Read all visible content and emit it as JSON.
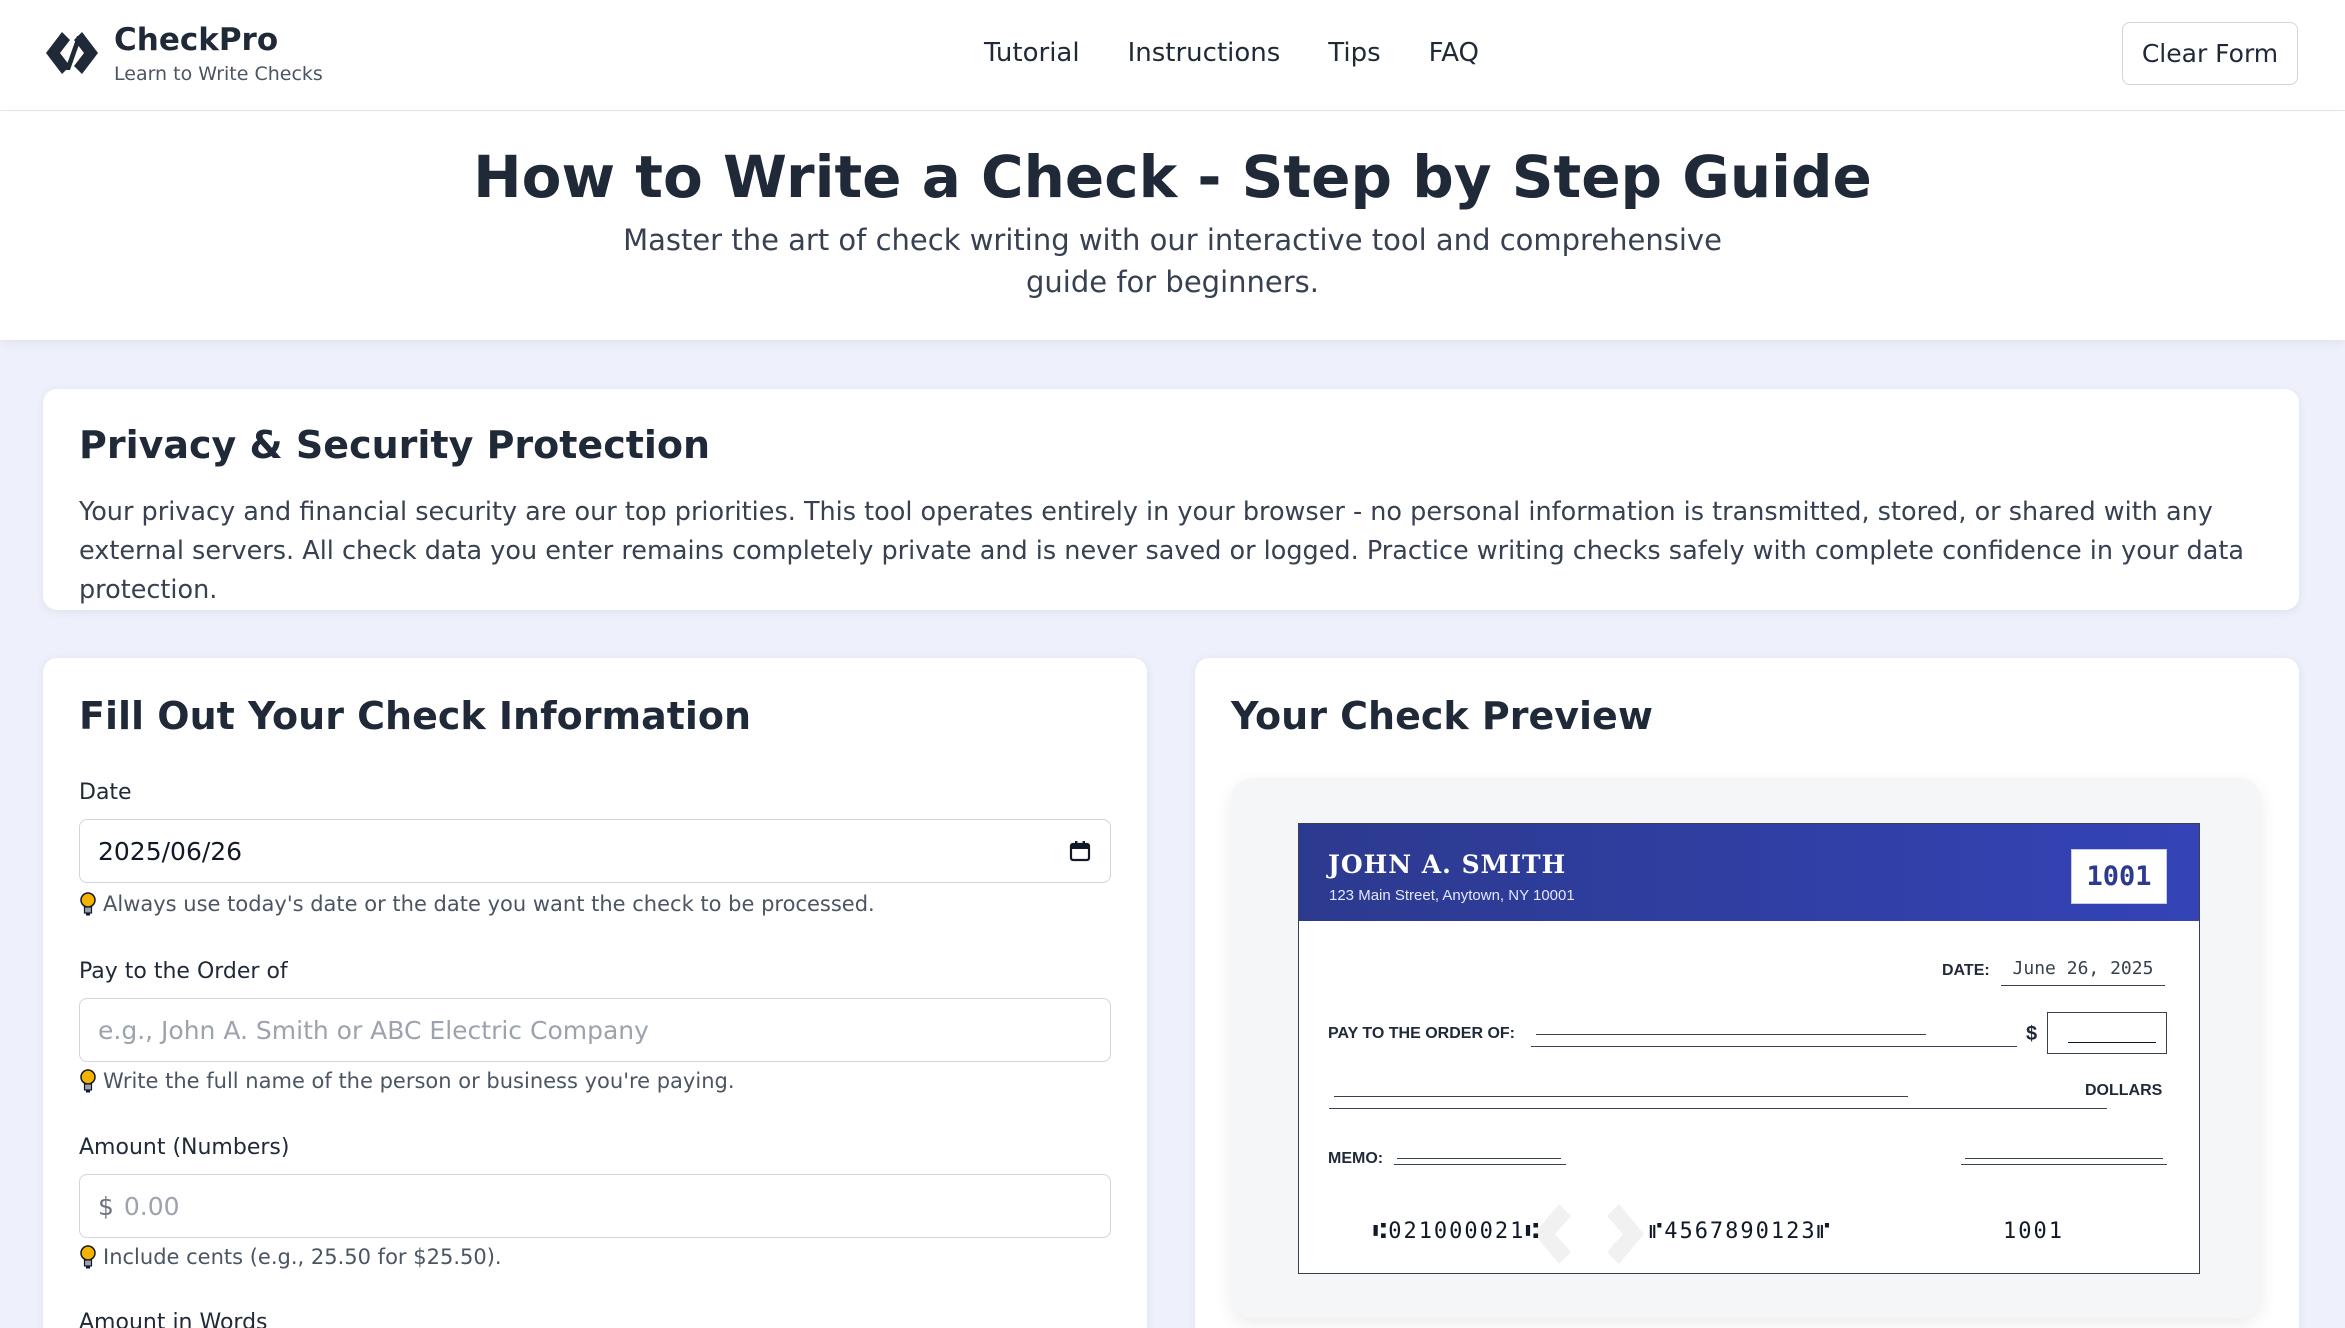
{
  "header": {
    "brand_name": "CheckPro",
    "brand_tagline": "Learn to Write Checks",
    "nav": [
      "Tutorial",
      "Instructions",
      "Tips",
      "FAQ"
    ],
    "clear_button": "Clear Form"
  },
  "hero": {
    "title": "How to Write a Check - Step by Step Guide",
    "subtitle": "Master the art of check writing with our interactive tool and comprehensive guide for beginners."
  },
  "privacy": {
    "title": "Privacy & Security Protection",
    "text": "Your privacy and financial security are our top priorities. This tool operates entirely in your browser - no personal information is transmitted, stored, or shared with any external servers. All check data you enter remains completely private and is never saved or logged. Practice writing checks safely with complete confidence in your data protection."
  },
  "form": {
    "title": "Fill Out Your Check Information",
    "date_label": "Date",
    "date_value": "2025/06/26",
    "date_hint": "Always use today's date or the date you want the check to be processed.",
    "payee_label": "Pay to the Order of",
    "payee_placeholder": "e.g., John A. Smith or ABC Electric Company",
    "payee_hint": "Write the full name of the person or business you're paying.",
    "amount_label": "Amount (Numbers)",
    "amount_symbol": "$",
    "amount_placeholder": "0.00",
    "amount_hint": "Include cents (e.g., 25.50 for $25.50).",
    "words_label": "Amount in Words"
  },
  "preview": {
    "title": "Your Check Preview",
    "owner": "JOHN A. SMITH",
    "address": "123 Main Street, Anytown, NY 10001",
    "check_number": "1001",
    "date_label": "DATE:",
    "date_value": "June 26, 2025",
    "payee_label": "PAY TO THE ORDER OF:",
    "dollar_sign": "$",
    "dollars_label": "DOLLARS",
    "memo_label": "MEMO:",
    "routing": "⑆021000021⑆",
    "account": "⑈4567890123⑈",
    "micr_check_number": "1001"
  },
  "colors": {
    "accent": "#3443b6",
    "page_bg": "#eef1fb",
    "text": "#1f2937",
    "hint_bulb": "#f5b301"
  },
  "icons": {
    "logo": "checkpro-logo-icon",
    "calendar": "calendar-icon",
    "hint": "lightbulb-icon"
  }
}
